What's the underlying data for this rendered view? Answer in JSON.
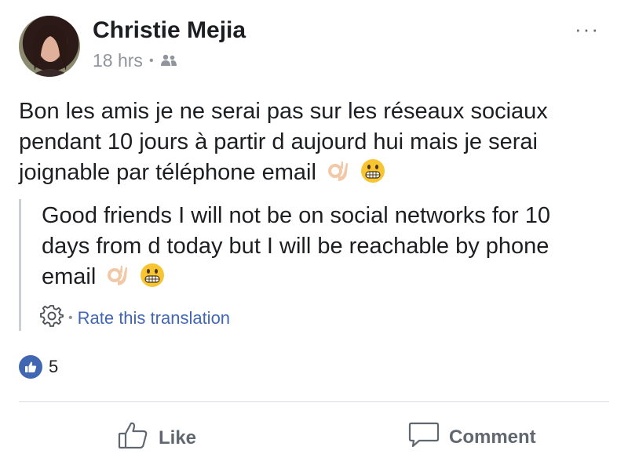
{
  "post": {
    "author": "Christie Mejia",
    "timestamp": "18 hrs",
    "privacy_icon": "friends-icon",
    "more_label": "···",
    "text": "Bon les amis je ne serai pas sur les réseaux sociaux pendant 10 jours à partir d aujourd hui mais je serai joignable par téléphone email",
    "text_emojis": [
      "ok-hand-emoji",
      "grinning-face-emoji"
    ]
  },
  "translation": {
    "text": "Good friends I will not be on social networks for 10 days from d today but I will be reachable by phone email",
    "text_emojis": [
      "ok-hand-emoji",
      "grinning-face-emoji"
    ],
    "rate_label": "Rate this translation",
    "settings_icon": "gear-icon"
  },
  "reactions": {
    "count": "5",
    "icon": "thumbs-up-icon",
    "color": "#4267b2"
  },
  "actions": {
    "like_label": "Like",
    "comment_label": "Comment"
  }
}
